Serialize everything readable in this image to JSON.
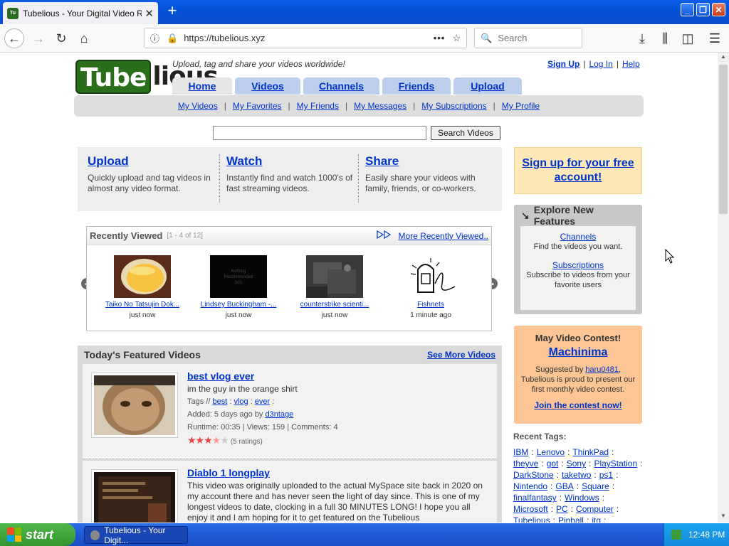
{
  "browser": {
    "tab_title": "Tubelious - Your Digital Video Repo",
    "favicon_text": "Tube lious",
    "url": "https://tubelious.xyz",
    "search_placeholder": "Search"
  },
  "site": {
    "logo_part1": "Tube",
    "logo_part2": "lious",
    "tagline": "Upload, tag and share your videos worldwide!",
    "toplinks": {
      "signup": "Sign Up",
      "login": "Log In",
      "help": "Help",
      "sep": "|"
    },
    "tabs": [
      "Home",
      "Videos",
      "Channels",
      "Friends",
      "Upload"
    ],
    "subnav": [
      "My Videos",
      "My Favorites",
      "My Friends",
      "My Messages",
      "My Subscriptions",
      "My Profile"
    ],
    "search_button": "Search Videos"
  },
  "promo": [
    {
      "title": "Upload",
      "desc": "Quickly upload and tag videos in almost any video format."
    },
    {
      "title": "Watch",
      "desc": "Instantly find and watch 1000's of fast streaming videos."
    },
    {
      "title": "Share",
      "desc": "Easily share your videos with family, friends, or co-workers."
    }
  ],
  "signup_box": "Sign up for your free account!",
  "recently_viewed": {
    "title": "Recently Viewed",
    "count": "[1 - 4 of 12]",
    "more": "More Recently Viewed..",
    "items": [
      {
        "title": "Taiko No Tatsujin Dok...",
        "time": "just now"
      },
      {
        "title": "Lindsey Buckingham -...",
        "time": "just now",
        "thumb_text": "Nothing\nRecommended\n(x2)"
      },
      {
        "title": "counterstrike scienti...",
        "time": "just now"
      },
      {
        "title": "Fishnets",
        "time": "1 minute ago"
      }
    ]
  },
  "featured": {
    "title": "Today's Featured Videos",
    "more": "See More Videos",
    "items": [
      {
        "title": "best vlog ever",
        "desc": "im the guy in the orange shirt",
        "tags_label": "Tags //",
        "tags": [
          "best",
          "vlog",
          "ever"
        ],
        "added": "Added: 5 days ago by",
        "user": "d3ntage",
        "stats": "Runtime: 00:35 | Views: 159 | Comments: 4",
        "rating": 3.5,
        "ratings_text": "(5 ratings)"
      },
      {
        "title": "Diablo 1 longplay",
        "desc": "This video was originally uploaded to the actual MySpace site back in 2020 on my account there and has never seen the light of day since. This is one of my longest videos to date, clocking in a full 30 MINUTES LONG! I hope you all enjoy it and I am hoping for it to get featured on the Tubelious"
      }
    ]
  },
  "explore": {
    "title": "Explore New Features",
    "items": [
      {
        "link": "Channels",
        "desc": "Find the videos you want."
      },
      {
        "link": "Subscriptions",
        "desc": "Subscribe to videos from your favorite users"
      }
    ]
  },
  "contest": {
    "heading": "May Video Contest!",
    "name": "Machinima",
    "suggested": "Suggested by",
    "user": "haru0481",
    "text": "Tubelious is proud to present our first monthly video contest.",
    "join": "Join the contest now!"
  },
  "recent_tags": {
    "title": "Recent Tags:",
    "tags": [
      "IBM",
      "Lenovo",
      "ThinkPad",
      "theyve",
      "got",
      "Sony",
      "PlayStation",
      "DarkStone",
      "taketwo",
      "ps1",
      "Nintendo",
      "GBA",
      "Square",
      "finalfantasy",
      "Windows",
      "Microsoft",
      "PC",
      "Computer",
      "Tubelious",
      "Pinball",
      "itg"
    ]
  },
  "taskbar": {
    "start": "start",
    "task": "Tubelious - Your Digit...",
    "clock": "12:48 PM"
  },
  "colors": {
    "link": "#0033cc",
    "tab_active": "#e6e6e6",
    "tab_inactive": "#bcd0ee",
    "signup_bg": "#fde9b8",
    "contest_bg": "#fbc595",
    "logo_green": "#2a6e1c"
  }
}
